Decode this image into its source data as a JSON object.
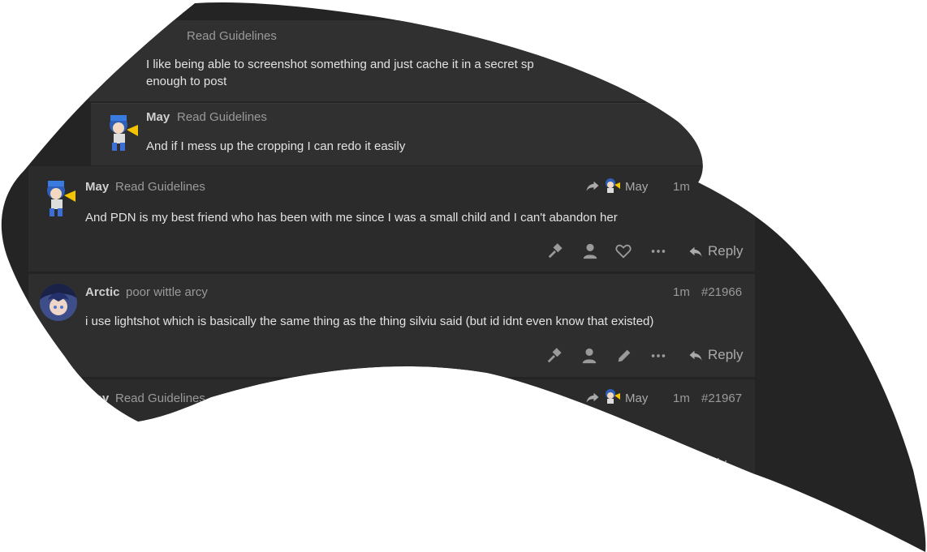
{
  "posts": [
    {
      "username": "",
      "user_title": "Read Guidelines",
      "body_lines": [
        "I like being able to screenshot something and just cache it in a secret sp",
        "enough to post"
      ]
    },
    {
      "username": "May",
      "user_title": "Read Guidelines",
      "body": "And if I mess up the cropping I can redo it easily"
    },
    {
      "username": "May",
      "user_title": "Read Guidelines",
      "reply_to_name": "May",
      "time": "1m",
      "body": "And PDN is my best friend who has been with me since I was a small child and I can't abandon her",
      "reply_label": "Reply"
    },
    {
      "username": "Arctic",
      "user_title": "poor wittle arcy",
      "time": "1m",
      "post_number": "#21966",
      "body": "i use lightshot which is basically the same thing as the thing silviu said (but id idnt even know that existed)",
      "reply_label": "Reply"
    },
    {
      "username": "May",
      "user_title": "Read Guidelines",
      "reply_to_name": "May",
      "time": "1m",
      "post_number": "#21967",
      "reply_label": "ly"
    }
  ],
  "icons": {
    "moderate": "hammer-icon",
    "admin": "user-icon",
    "like": "heart-icon",
    "edit": "pencil-icon",
    "more": "ellipsis-icon",
    "reply": "reply-arrow-icon",
    "reply_to": "share-arrow-icon"
  },
  "colors": {
    "background": "#242424",
    "post": "#2b2b2b",
    "nested_post": "#303030",
    "text": "#e2e2e2",
    "muted": "#9a9a9a"
  }
}
